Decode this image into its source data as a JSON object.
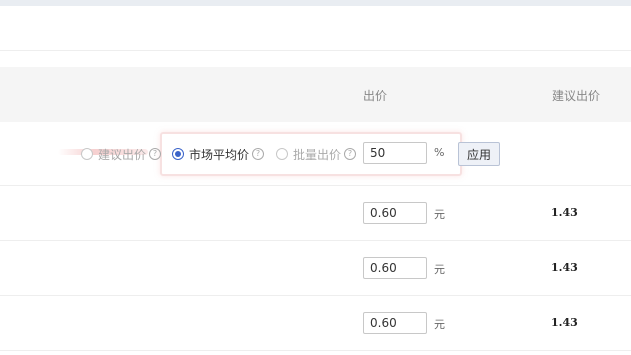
{
  "table": {
    "columns": {
      "bid": "出价",
      "suggested_bid": "建议出价"
    },
    "batch": {
      "options": [
        {
          "label": "建议出价",
          "checked": false,
          "help": "?"
        },
        {
          "label": "市场平均价",
          "checked": true,
          "help": "?"
        },
        {
          "label": "批量出价",
          "checked": false,
          "help": "?"
        }
      ],
      "value": "50",
      "unit": "%",
      "apply_label": "应用"
    },
    "rows": [
      {
        "bid": "0.60",
        "unit": "元",
        "suggested": "1.43"
      },
      {
        "bid": "0.60",
        "unit": "元",
        "suggested": "1.43"
      },
      {
        "bid": "0.60",
        "unit": "元",
        "suggested": "1.43"
      }
    ]
  },
  "colors": {
    "accent": "#3a63c9",
    "header_bg": "#f5f5f5",
    "highlight": "#f7e1e1"
  }
}
